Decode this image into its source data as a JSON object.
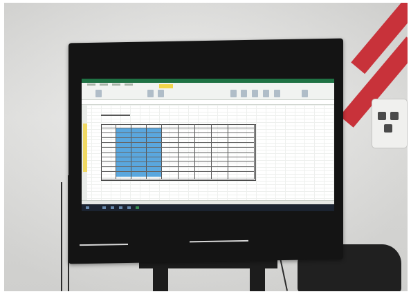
{
  "photo": {
    "subject_icons": [
      "tv-icon",
      "spreadsheet-icon",
      "chair-icon",
      "outlet-icon"
    ],
    "colors": {
      "wall": "#dadad8",
      "stripe": "#c8323a",
      "bezel": "#141414",
      "excel_green": "#1f7244",
      "highlight_blue": "#5aa7de",
      "highlight_yellow": "#f1d64b"
    }
  }
}
